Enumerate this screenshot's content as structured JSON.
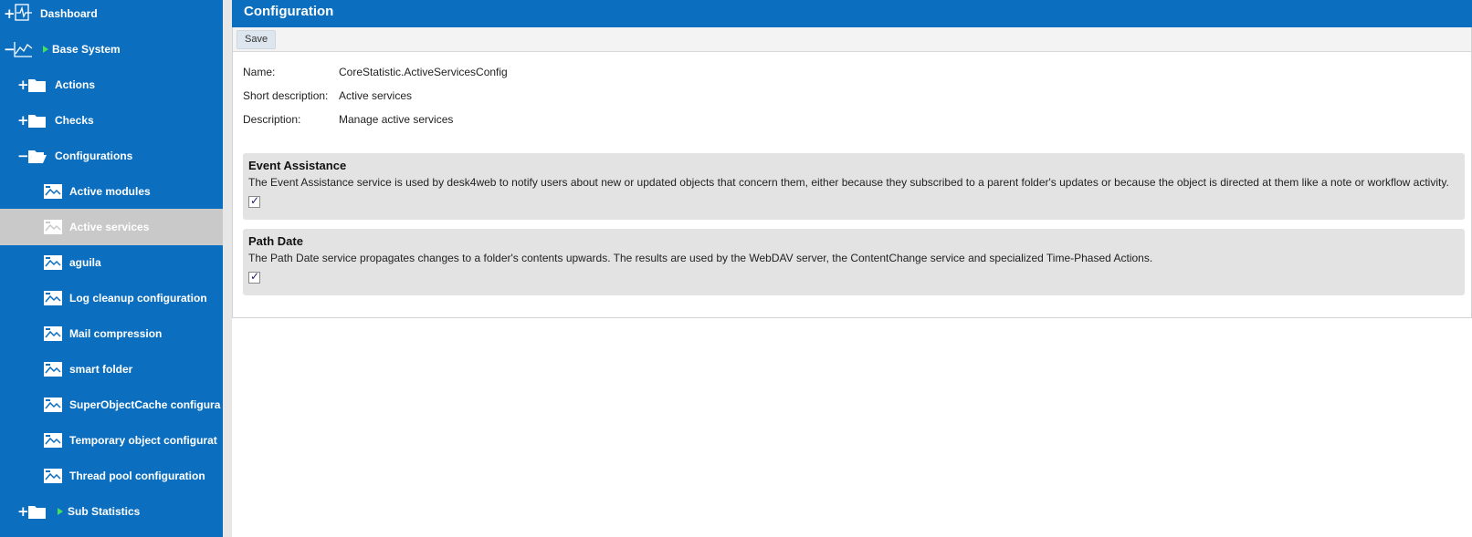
{
  "sidebar": {
    "items": [
      {
        "label": "Dashboard",
        "toggle": "+",
        "icon": "dashboard-icon"
      },
      {
        "label": "Base System",
        "toggle": "−",
        "icon": "chart-line-icon",
        "has_arrow": true
      },
      {
        "label": "Actions",
        "toggle": "+",
        "icon": "folder-icon"
      },
      {
        "label": "Checks",
        "toggle": "+",
        "icon": "folder-icon"
      },
      {
        "label": "Configurations",
        "toggle": "−",
        "icon": "folder-open-icon"
      },
      {
        "label": "Active modules",
        "icon": "config-icon"
      },
      {
        "label": "Active services",
        "icon": "config-icon",
        "active": true
      },
      {
        "label": "aguila",
        "icon": "config-icon"
      },
      {
        "label": "Log cleanup configuration",
        "icon": "config-icon"
      },
      {
        "label": "Mail compression",
        "icon": "config-icon"
      },
      {
        "label": "smart folder",
        "icon": "config-icon"
      },
      {
        "label": "SuperObjectCache configura",
        "icon": "config-icon"
      },
      {
        "label": "Temporary object configurat",
        "icon": "config-icon"
      },
      {
        "label": "Thread pool configuration",
        "icon": "config-icon"
      },
      {
        "label": "Sub Statistics",
        "toggle": "+",
        "icon": "folder-icon",
        "has_arrow": true
      }
    ]
  },
  "header": {
    "title": "Configuration"
  },
  "toolbar": {
    "save_label": "Save"
  },
  "properties": {
    "name_label": "Name:",
    "name_value": "CoreStatistic.ActiveServicesConfig",
    "short_label": "Short description:",
    "short_value": "Active services",
    "desc_label": "Description:",
    "desc_value": "Manage active services"
  },
  "services": [
    {
      "title": "Event Assistance",
      "description": "The Event Assistance service is used by desk4web to notify users about new or updated objects that concern them, either because they subscribed to a parent folder's updates or because the object is directed at them like a note or workflow activity.",
      "checked": true
    },
    {
      "title": "Path Date",
      "description": "The Path Date service propagates changes to a folder's contents upwards. The results are used by the WebDAV server, the ContentChange service and specialized Time-Phased Actions.",
      "checked": true
    }
  ],
  "colors": {
    "brand": "#0b6ebf",
    "active_item": "#c9c9c9",
    "arrow": "#45e05a"
  }
}
